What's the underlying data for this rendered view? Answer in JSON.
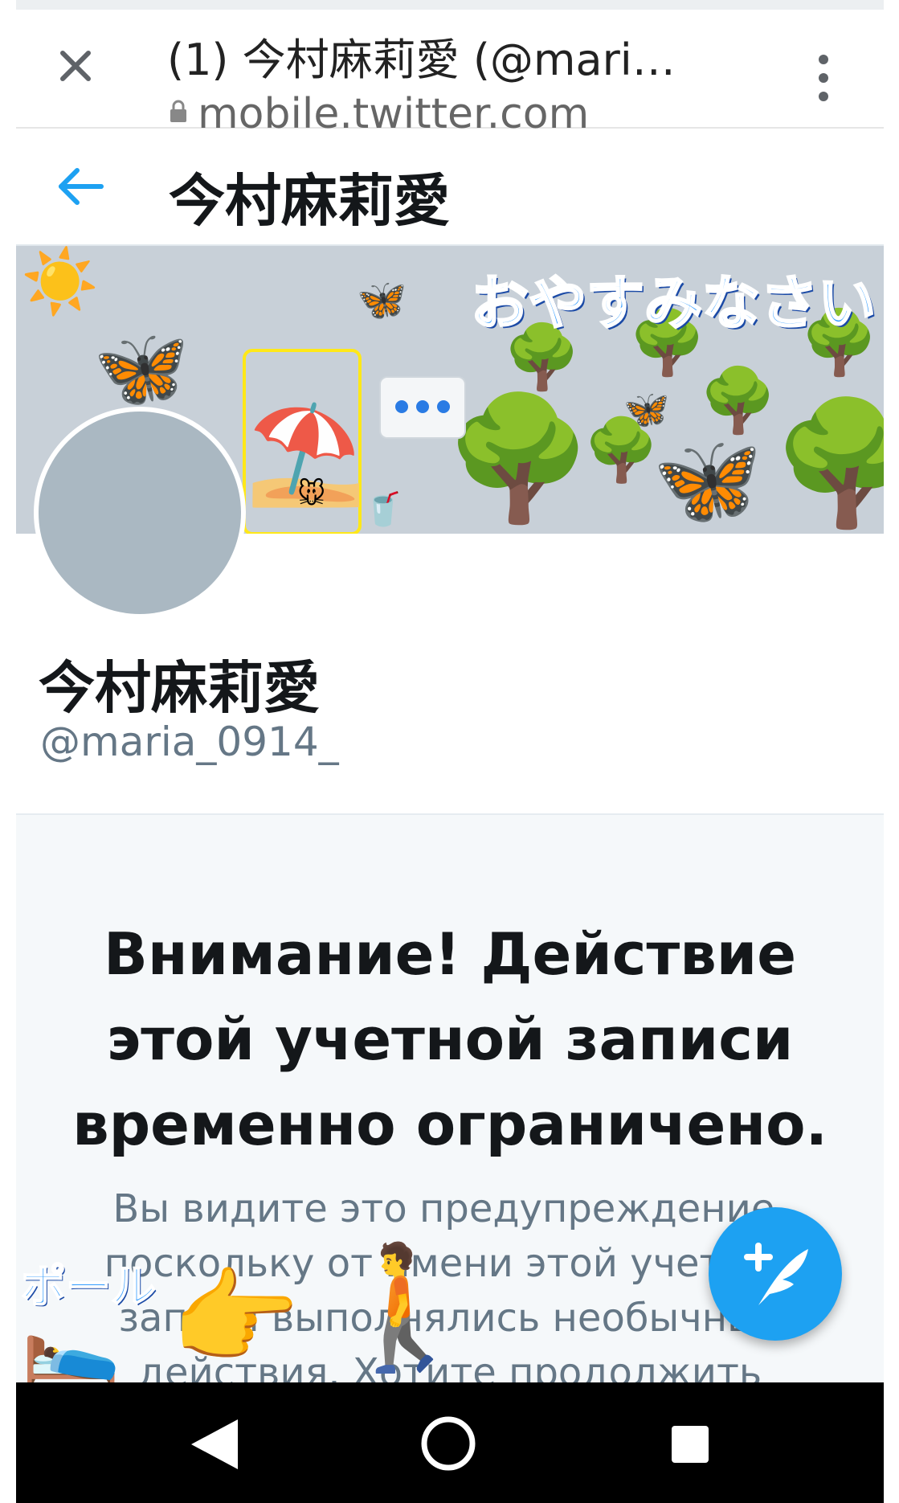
{
  "browser": {
    "tab_title": "(1) 今村麻莉愛 (@mari…",
    "url": "mobile.twitter.com",
    "close_icon": "close-icon",
    "lock_icon": "lock-icon",
    "menu_icon": "more-vert-icon"
  },
  "header": {
    "back_icon": "arrow-left-icon",
    "title": "今村麻莉愛"
  },
  "banner": {
    "caption": "おやすみなさい",
    "emojis": {
      "sun": "☀️",
      "butterfly": "🦋",
      "umbrella": "⛱️",
      "mouse": "🐭",
      "cup": "🥤",
      "tree": "🌳"
    }
  },
  "profile": {
    "name": "今村麻莉愛",
    "handle": "@maria_0914_"
  },
  "warning": {
    "title": "Внимание! Действие этой учетной записи временно ограничено.",
    "body": "Вы видите это предупреждение, поскольку от имени этой учетной записи выполнялись необычные действия. Хотите продолжить"
  },
  "stickers": {
    "text": "ポール",
    "sleeping": "🛌",
    "pointing": "👉",
    "walking": "🚶"
  },
  "fab": {
    "icon": "compose-tweet-icon"
  },
  "nav": {
    "back_icon": "nav-back-icon",
    "home_icon": "nav-home-icon",
    "recent_icon": "nav-recent-icon"
  },
  "colors": {
    "accent": "#1da1f2",
    "banner_bg": "#c8d0d8",
    "avatar_bg": "#aab8c2",
    "handle": "#657786"
  }
}
